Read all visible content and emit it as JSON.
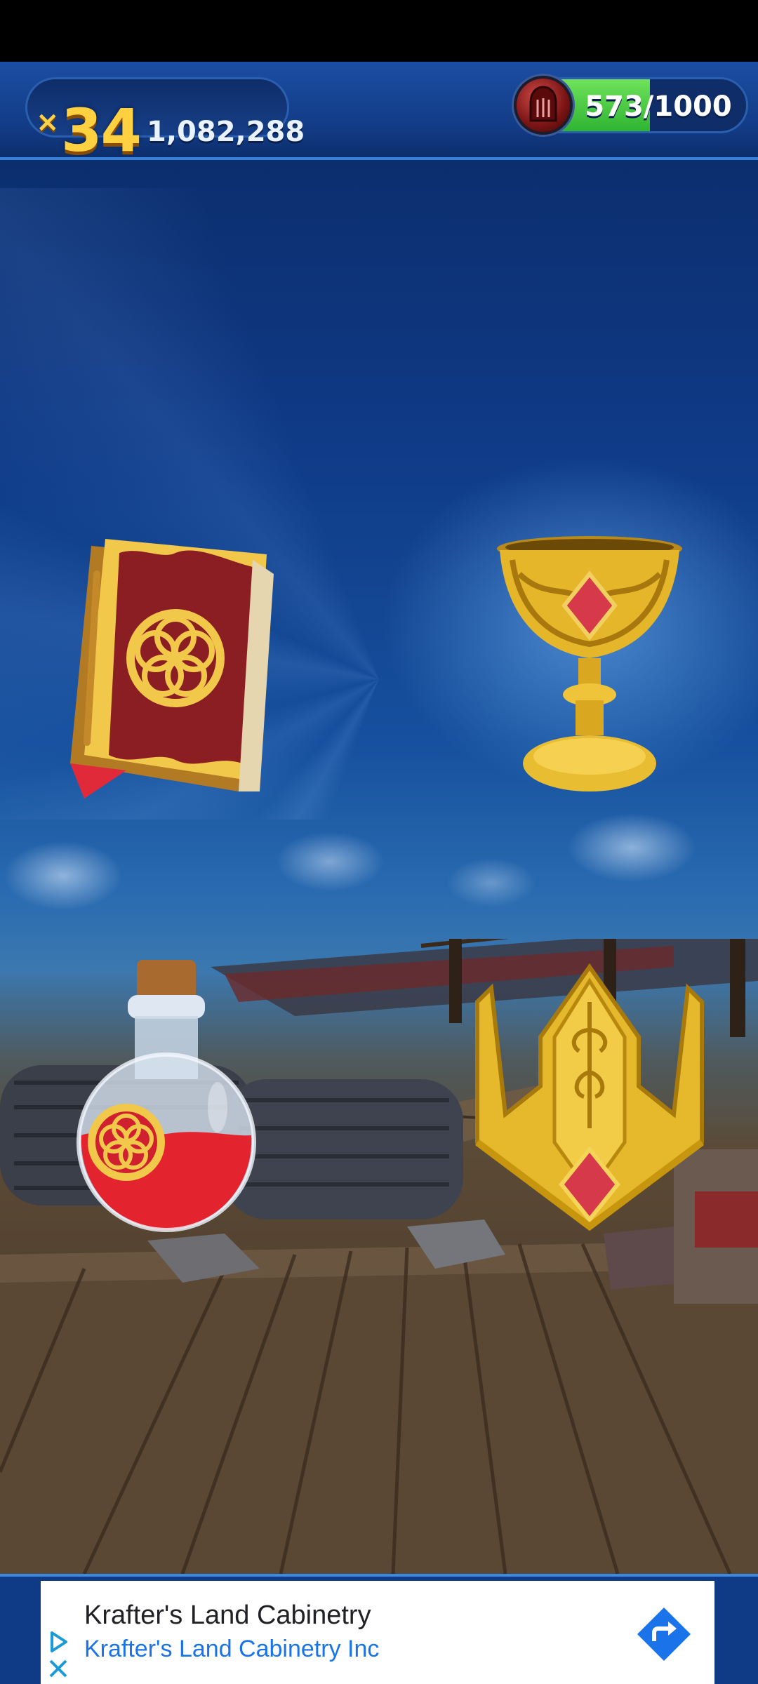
{
  "hud": {
    "multiplier_prefix": "×",
    "multiplier": "34",
    "score": "1,082,288",
    "progress_text": "573/1000",
    "progress_value": 573,
    "progress_max": 1000,
    "helmet_icon": "knight-helmet-icon"
  },
  "artifacts": [
    {
      "name": "spell-book",
      "icon": "book-icon"
    },
    {
      "name": "golden-chalice",
      "icon": "chalice-icon"
    },
    {
      "name": "red-potion",
      "icon": "potion-icon"
    },
    {
      "name": "golden-crown",
      "icon": "crown-icon"
    }
  ],
  "ad": {
    "title": "Krafter's Land Cabinetry",
    "subtitle": "Krafter's Land Cabinetry Inc",
    "adchoices_icon": "adchoices-icon",
    "close_icon": "close-icon",
    "cta_icon": "directions-arrow-icon"
  },
  "colors": {
    "hud_bg": "#1b4ea3",
    "gold": "#ffd040",
    "progress_green": "#2fb433",
    "ad_link_blue": "#1a73e8"
  }
}
